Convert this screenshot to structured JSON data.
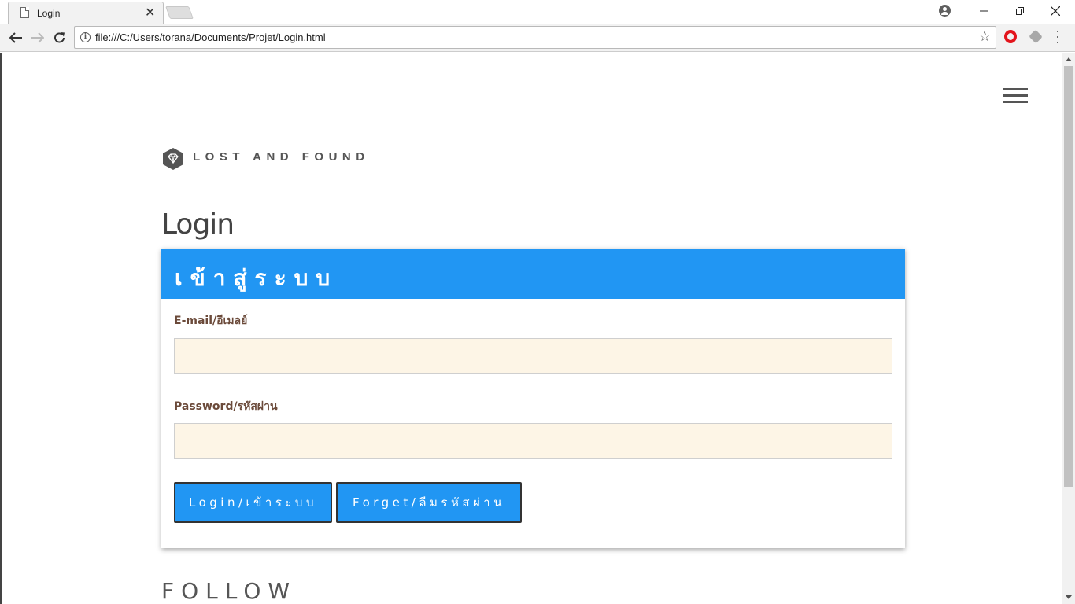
{
  "browser": {
    "tab_title": "Login",
    "url": "file:///C:/Users/torana/Documents/Projet/Login.html",
    "icons": [
      "document-icon",
      "close-icon",
      "profile-icon",
      "minimize-icon",
      "restore-icon",
      "close-window-icon",
      "back-icon",
      "forward-icon",
      "reload-icon",
      "info-icon",
      "star-icon",
      "opera-icon",
      "extension-icon",
      "menu-icon"
    ]
  },
  "page": {
    "brand": "LOST AND FOUND",
    "title": "Login",
    "card_header": "เข้าสู่ระบบ",
    "email_label": "E-mail/อีเมลย์",
    "email_value": "",
    "password_label": "Password/รหัสผ่าน",
    "password_value": "",
    "login_button": "Login/เข้าระบบ",
    "forget_button": "Forget/ลืมรหัสผ่าน",
    "follow": "FOLLOW"
  },
  "colors": {
    "accent": "#2196f3",
    "input_bg": "#fdf5e6",
    "label": "#6b4a3a",
    "text_dark": "#444444"
  }
}
